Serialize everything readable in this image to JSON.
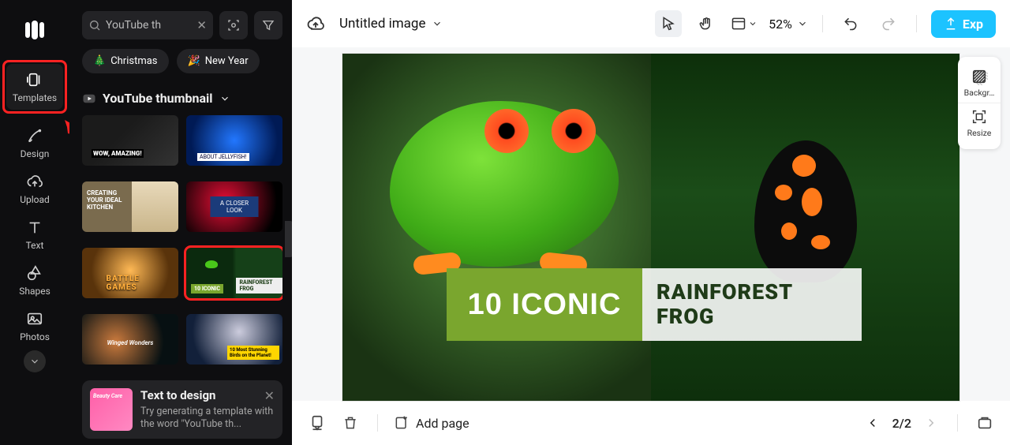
{
  "rail": {
    "templates": "Templates",
    "design": "Design",
    "upload": "Upload",
    "text": "Text",
    "shapes": "Shapes",
    "photos": "Photos"
  },
  "panel": {
    "search_value": "YouTube th",
    "chip_christmas": "Christmas",
    "chip_newyear": "New Year",
    "section_title": "YouTube thumbnail",
    "t2d_title": "Text to design",
    "t2d_body": "Try generating a template with the word \"YouTube th...",
    "thumb6_left": "10 ICONIC",
    "thumb6_right": "RAINFOREST FROG"
  },
  "topbar": {
    "title": "Untitled image",
    "zoom": "52%",
    "export": "Exp"
  },
  "canvas": {
    "label1": "10 ICONIC",
    "label2_line1": "RAINFOREST",
    "label2_line2": "FROG"
  },
  "right_tools": {
    "background": "Backgr…",
    "resize": "Resize"
  },
  "bottombar": {
    "addpage": "Add page",
    "pager": "2/2"
  }
}
